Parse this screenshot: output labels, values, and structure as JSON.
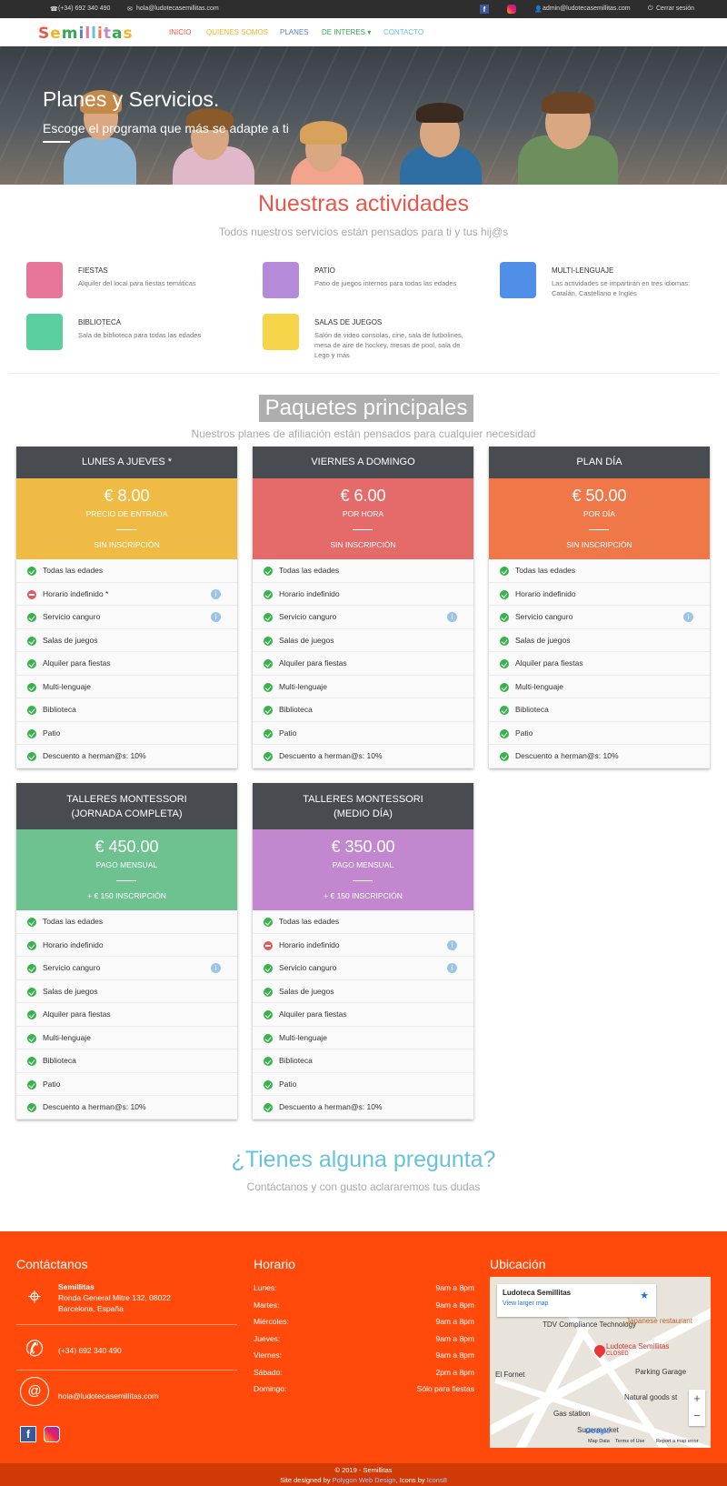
{
  "topbar": {
    "phone": "(+34) 692 340 490",
    "email": "hola@ludotecasemillitas.com",
    "admin": "admin@ludotecasemillitas.com",
    "logout": "Cerrar sesión"
  },
  "nav": {
    "logo": "Semillitas",
    "items": [
      {
        "label": "INICIO",
        "color": "#e8574b"
      },
      {
        "label": "QUIENES SOMOS",
        "color": "#f0b429"
      },
      {
        "label": "PLANES",
        "color": "#5b7fc9"
      },
      {
        "label": "DE INTERES",
        "color": "#36a852"
      },
      {
        "label": "CONTACTO",
        "color": "#67c3dc"
      }
    ]
  },
  "hero": {
    "title": "Planes y Servicios.",
    "subtitle": "Escoge el programa que más se adapte a ti"
  },
  "activities": {
    "title": "Nuestras actividades",
    "subtitle": "Todos nuestros servicios están pensados para ti y tus hij@s",
    "items": [
      {
        "title": "FIESTAS",
        "desc": "Alquiler del local para fiestas temáticas",
        "color": "#e7759a",
        "icon": "gift-icon"
      },
      {
        "title": "PATIO",
        "desc": "Patio de juegos internos para todas las edades",
        "color": "#b58ad8",
        "icon": "house-icon"
      },
      {
        "title": "MULTI-LENGUAJE",
        "desc": "Las actividades se impartirán en tres idiomas: Catalán, Castellano e Inglés",
        "color": "#4f8fe8",
        "icon": "translate-icon"
      },
      {
        "title": "BIBLIOTECA",
        "desc": "Sala de biblioteca para todas las edades",
        "color": "#5ccf9e",
        "icon": "book-icon"
      },
      {
        "title": "SALAS DE JUEGOS",
        "desc": "Salón de video consolas, cine, sala de futbolines, mesa de aire de hockey, mesas de pool, sala de Lego y más",
        "color": "#f6d54a",
        "icon": "joystick-icon"
      }
    ]
  },
  "packages": {
    "title": "Paquetes principales",
    "subtitle": "Nuestros planes de afiliación están pensados para cualquier necesidad",
    "cards": [
      {
        "name": "LUNES A JUEVES *",
        "price": "€ 8.00",
        "unit": "PRECIO DE ENTRADA",
        "inscription": "SIN INSCRIPCIÓN",
        "color": "#f0bb45",
        "features": [
          [
            "Todas las edades",
            "ok",
            false
          ],
          [
            "Horario indefinido *",
            "no",
            true
          ],
          [
            "Servicio canguro",
            "ok",
            true
          ],
          [
            "Salas de juegos",
            "ok",
            false
          ],
          [
            "Alquiler para fiestas",
            "ok",
            false
          ],
          [
            "Multi-lenguaje",
            "ok",
            false
          ],
          [
            "Biblioteca",
            "ok",
            false
          ],
          [
            "Patio",
            "ok",
            false
          ],
          [
            "Descuento a herman@s: 10%",
            "ok",
            false
          ]
        ]
      },
      {
        "name": "VIERNES A DOMINGO",
        "price": "€ 6.00",
        "unit": "POR HORA",
        "inscription": "SIN INSCRIPCIÓN",
        "color": "#e56a6a",
        "features": [
          [
            "Todas las edades",
            "ok",
            false
          ],
          [
            "Horario indefinido",
            "ok",
            false
          ],
          [
            "Servicio canguro",
            "ok",
            true
          ],
          [
            "Salas de juegos",
            "ok",
            false
          ],
          [
            "Alquiler para fiestas",
            "ok",
            false
          ],
          [
            "Multi-lenguaje",
            "ok",
            false
          ],
          [
            "Biblioteca",
            "ok",
            false
          ],
          [
            "Patio",
            "ok",
            false
          ],
          [
            "Descuento a herman@s: 10%",
            "ok",
            false
          ]
        ]
      },
      {
        "name": "PLAN DÍA",
        "price": "€ 50.00",
        "unit": "POR DÍA",
        "inscription": "SIN INSCRIPCIÓN",
        "color": "#ef7748",
        "features": [
          [
            "Todas las edades",
            "ok",
            false
          ],
          [
            "Horario indefinido",
            "ok",
            false
          ],
          [
            "Servicio canguro",
            "ok",
            true
          ],
          [
            "Salas de juegos",
            "ok",
            false
          ],
          [
            "Alquiler para fiestas",
            "ok",
            false
          ],
          [
            "Multi-lenguaje",
            "ok",
            false
          ],
          [
            "Biblioteca",
            "ok",
            false
          ],
          [
            "Patio",
            "ok",
            false
          ],
          [
            "Descuento a herman@s: 10%",
            "ok",
            false
          ]
        ]
      },
      {
        "name": "TALLERES MONTESSORI",
        "name2": "(JORNADA COMPLETA)",
        "price": "€ 450.00",
        "unit": "PAGO MENSUAL",
        "inscription": "+ € 150 INSCRIPCIÓN",
        "color": "#6dc28f",
        "features": [
          [
            "Todas las edades",
            "ok",
            false
          ],
          [
            "Horario indefinido",
            "ok",
            false
          ],
          [
            "Servicio canguro",
            "ok",
            true
          ],
          [
            "Salas de juegos",
            "ok",
            false
          ],
          [
            "Alquiler para fiestas",
            "ok",
            false
          ],
          [
            "Multi-lenguaje",
            "ok",
            false
          ],
          [
            "Biblioteca",
            "ok",
            false
          ],
          [
            "Patio",
            "ok",
            false
          ],
          [
            "Descuento a herman@s: 10%",
            "ok",
            false
          ]
        ]
      },
      {
        "name": "TALLERES MONTESSORI",
        "name2": "(MEDIO DÍA)",
        "price": "€ 350.00",
        "unit": "PAGO MENSUAL",
        "inscription": "+ € 150 INSCRIPCIÓN",
        "color": "#c387d0",
        "features": [
          [
            "Todas las edades",
            "ok",
            false
          ],
          [
            "Horario indefinido",
            "no",
            true
          ],
          [
            "Servicio canguro",
            "ok",
            true
          ],
          [
            "Salas de juegos",
            "ok",
            false
          ],
          [
            "Alquiler para fiestas",
            "ok",
            false
          ],
          [
            "Multi-lenguaje",
            "ok",
            false
          ],
          [
            "Biblioteca",
            "ok",
            false
          ],
          [
            "Patio",
            "ok",
            false
          ],
          [
            "Descuento a herman@s: 10%",
            "ok",
            false
          ]
        ]
      }
    ]
  },
  "question": {
    "title": "¿Tienes alguna pregunta?",
    "subtitle": "Contáctanos y con gusto aclararemos tus dudas"
  },
  "footer": {
    "contact_title": "Contáctanos",
    "name": "Semillitas",
    "address1": "Ronda General Mitre 132, 08022",
    "address2": "Barcelona, España",
    "phone": "(+34) 692 340 490",
    "email": "hola@ludotecasemillitas.com",
    "schedule_title": "Horario",
    "schedule": [
      [
        "Lunes:",
        "9am a 8pm"
      ],
      [
        "Martes:",
        "9am a 8pm"
      ],
      [
        "Miércoles:",
        "9am a 8pm"
      ],
      [
        "Jueves:",
        "9am a 8pm"
      ],
      [
        "Viernes:",
        "9am a 8pm"
      ],
      [
        "Sábado:",
        "2pm a 8pm"
      ],
      [
        "Domingo:",
        "Sólo para fiestas"
      ]
    ],
    "location_title": "Ubicación",
    "map": {
      "place": "Ludoteca Semillitas",
      "larger": "View larger map",
      "marker": "Ludoteca Semillitas",
      "marker_status": "CLOSED",
      "labels": [
        "TDV Compliance Technology",
        "Japanese restaurant",
        "El Fornet",
        "Parking Garage",
        "Natural goods st",
        "Gas station",
        "Supermarket",
        "Google",
        "Map Data",
        "Terms of Use",
        "Report a map error"
      ]
    },
    "copyright": "© 2019 - Semillitas",
    "credits_prefix": "Site designed by",
    "credits_designer": "Polygon Web Design",
    "credits_mid": ", Icons by",
    "credits_icons": "Icons8"
  }
}
